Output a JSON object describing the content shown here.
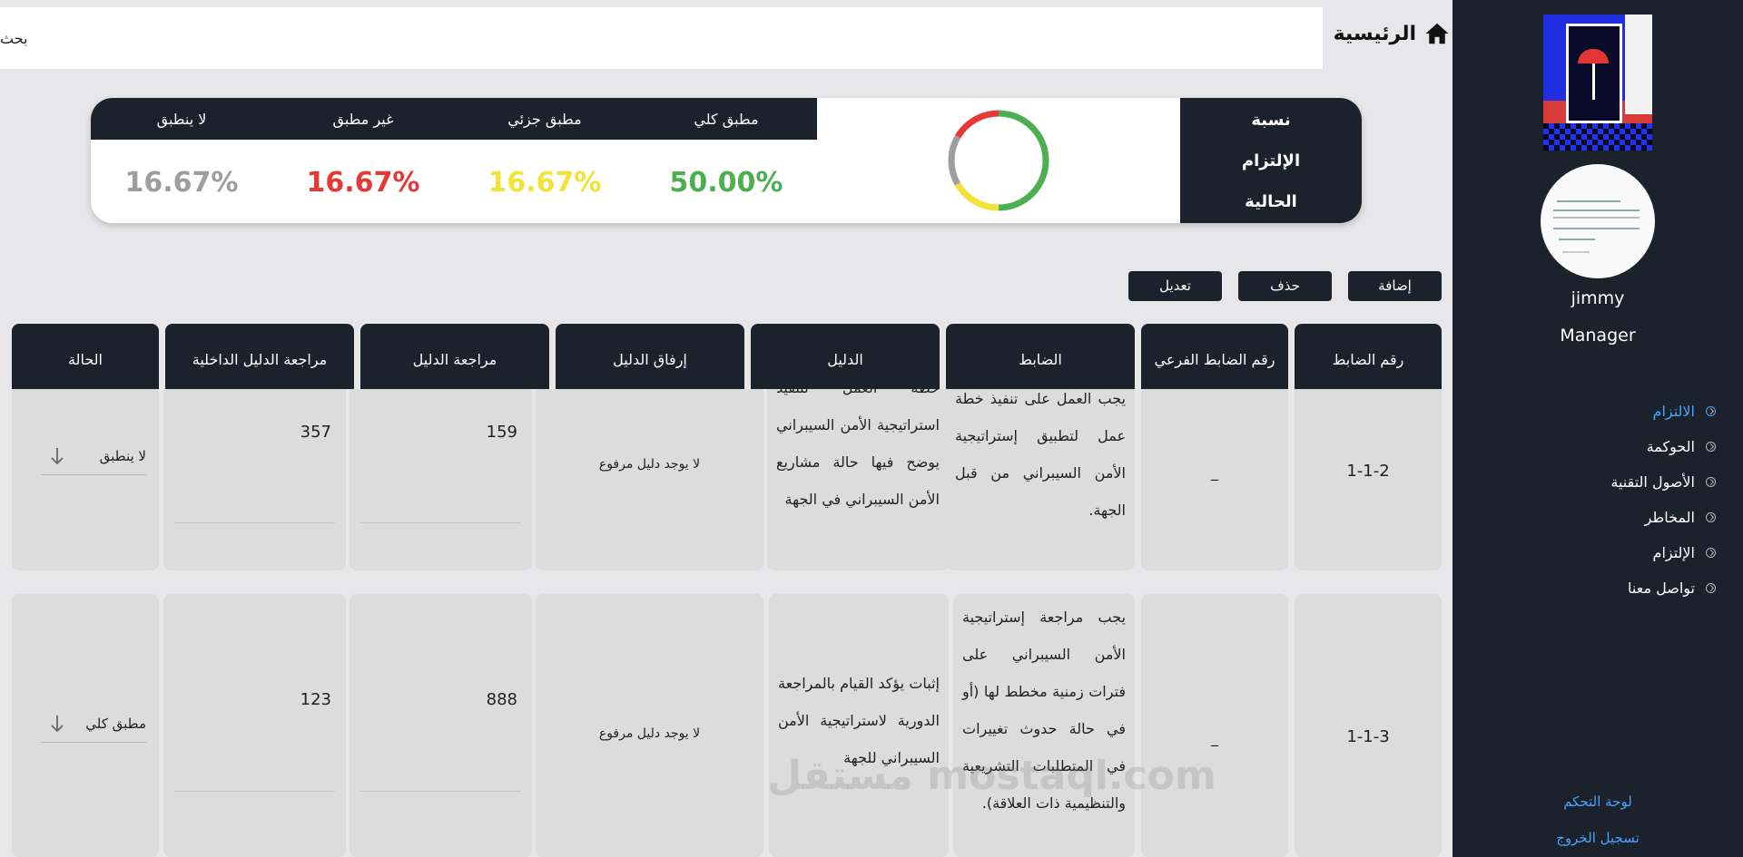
{
  "header": {
    "title": "الرئيسية",
    "search_placeholder": "بحث"
  },
  "sidebar": {
    "user_name": "jimmy",
    "user_role": "Manager",
    "menu": [
      {
        "label": "الالتزام",
        "active": true
      },
      {
        "label": "الحوكمة",
        "active": false
      },
      {
        "label": "الأصول التقنية",
        "active": false
      },
      {
        "label": "المخاطر",
        "active": false
      },
      {
        "label": "الإلتزام",
        "active": false
      },
      {
        "label": "تواصل معنا",
        "active": false
      }
    ],
    "dashboard_link": "لوحة التحكم",
    "logout_link": "تسجيل الخروج"
  },
  "compliance": {
    "label_line1": "نسبة",
    "label_line2": "الإلتزام",
    "label_line3": "الحالية",
    "stats": [
      {
        "label": "مطبق كلي",
        "value": "50.00%",
        "color": "#4caf50"
      },
      {
        "label": "مطبق جزئي",
        "value": "16.67%",
        "color": "#f2e33a"
      },
      {
        "label": "غير مطبق",
        "value": "16.67%",
        "color": "#e53935"
      },
      {
        "label": "لا ينطبق",
        "value": "16.67%",
        "color": "#9e9e9e"
      }
    ]
  },
  "actions": {
    "add": "إضافة",
    "delete": "حذف",
    "edit": "تعديل"
  },
  "table": {
    "columns": [
      "رقم الضابط",
      "رقم الضابط الفرعي",
      "الضابط",
      "الدليل",
      "إرفاق الدليل",
      "مراجعة الدليل",
      "مراجعة الدليل الداخلية",
      "الحالة"
    ],
    "rows": [
      {
        "id": "1-1-2",
        "sub_id": "_",
        "control": "يجب العمل على تنفيذ خطة عمل لتطبيق إستراتيجية الأمن السيبراني من قبل الجهة.",
        "evidence": "خطة العمل لتنفيذ استراتيجية الأمن السيبراني يوضح فيها حالة مشاريع الأمن السيبراني في الجهة",
        "attachment": "لا يوجد دليل مرفوع",
        "review": "159",
        "internal_review": "357",
        "status": "لا ينطبق"
      },
      {
        "id": "1-1-3",
        "sub_id": "_",
        "control": "يجب مراجعة إستراتيجية الأمن السيبراني على فترات زمنية مخطط لها (أو في حالة حدوث تغييرات في المتطلبات التشريعية والتنظيمية ذات العلاقة).",
        "evidence": "إثبات يؤكد القيام بالمراجعة الدورية لاستراتيجية الأمن السيبراني للجهة",
        "attachment": "لا يوجد دليل مرفوع",
        "review": "888",
        "internal_review": "123",
        "status": "مطبق كلي"
      }
    ]
  },
  "watermark": "مستقل mostaql.com"
}
